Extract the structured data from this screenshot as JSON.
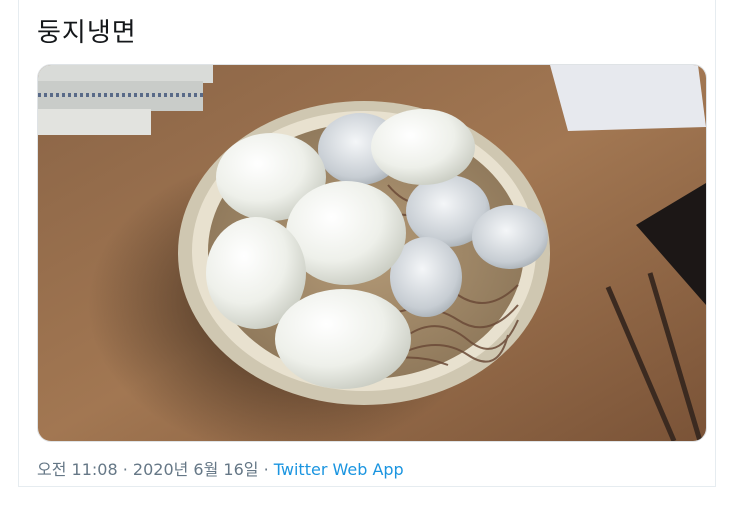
{
  "tweet": {
    "text": "둥지냉면",
    "time": "오전 11:08",
    "separator": " · ",
    "date": "2020년 6월 16일",
    "source": "Twitter Web App"
  },
  "colors": {
    "meta_text": "#657786",
    "link": "#1b95e0",
    "tweet_text": "#14171a"
  }
}
